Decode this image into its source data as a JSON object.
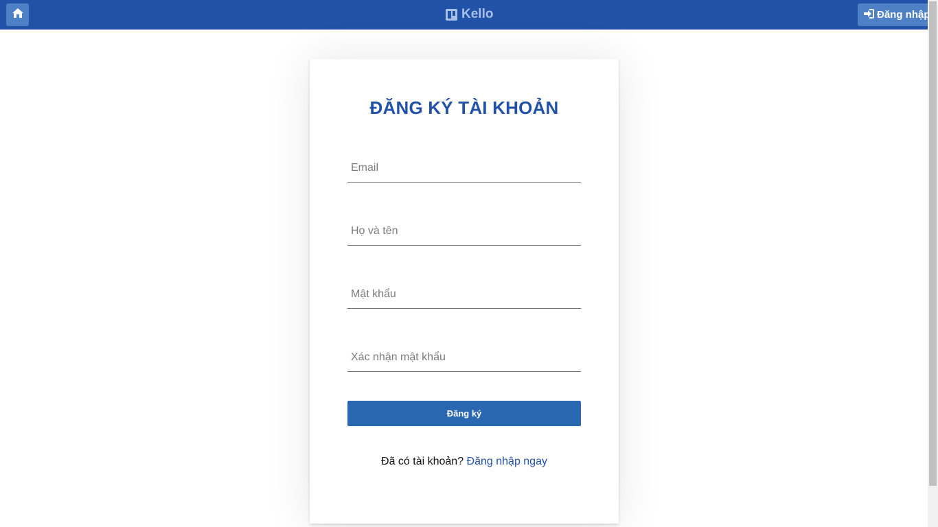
{
  "header": {
    "home_icon": "home-icon",
    "brand_icon": "board-icon",
    "brand_name": "Kello",
    "login_icon": "sign-in-icon",
    "login_label": "Đăng nhập"
  },
  "form": {
    "title": "ĐĂNG KÝ TÀI KHOẢN",
    "email": {
      "value": "",
      "placeholder": "Email"
    },
    "fullname": {
      "value": "",
      "placeholder": "Họ và tên"
    },
    "password": {
      "value": "",
      "placeholder": "Mật khẩu"
    },
    "confirm_password": {
      "value": "",
      "placeholder": "Xác nhận mật khẩu"
    },
    "submit_label": "Đăng ký",
    "footer_text": "Đã có tài khoản?",
    "footer_link": "Đăng nhập ngay"
  },
  "colors": {
    "primary": "#2251a8",
    "button": "#2a67b1",
    "header_button": "#4e80c6"
  }
}
